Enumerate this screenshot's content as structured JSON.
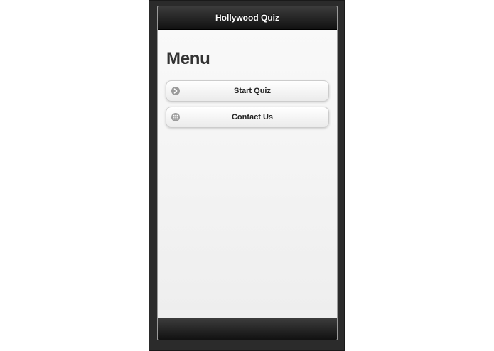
{
  "header": {
    "title": "Hollywood Quiz"
  },
  "main": {
    "title": "Menu",
    "menu_items": [
      {
        "label": "Start Quiz",
        "icon": "arrow-right-icon"
      },
      {
        "label": "Contact Us",
        "icon": "grid-icon"
      }
    ]
  },
  "colors": {
    "bar_background": "#111111",
    "page_background": "#f1f1f1",
    "icon_color": "#9b9b9b"
  }
}
